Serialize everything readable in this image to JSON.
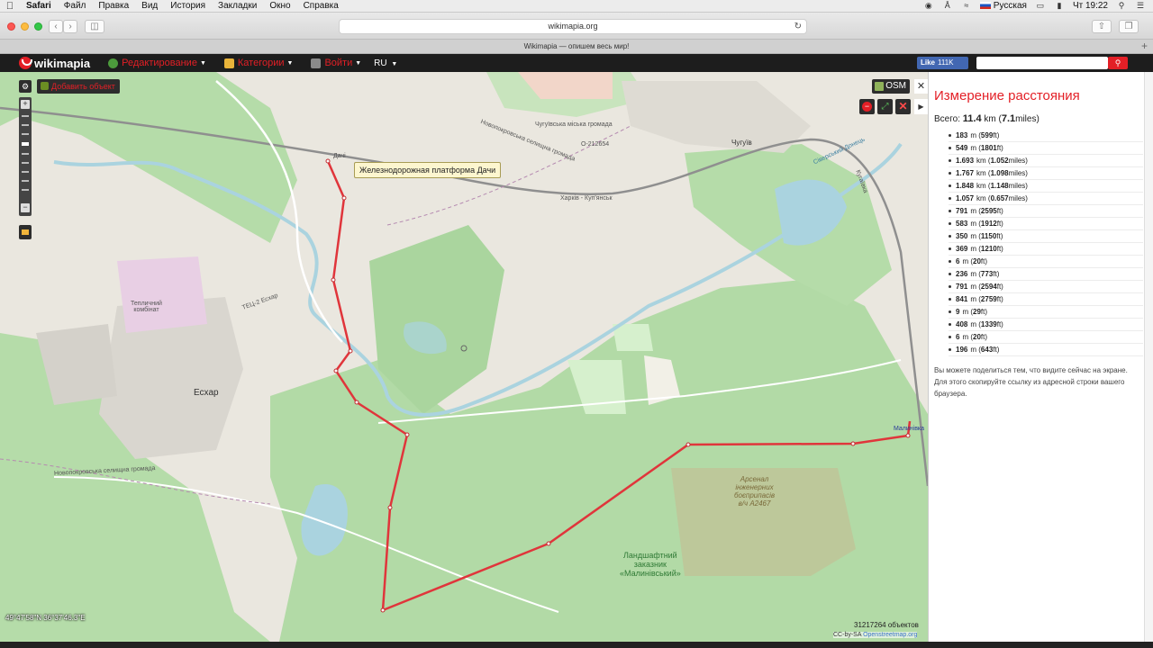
{
  "menubar": {
    "app": "Safari",
    "items": [
      "Файл",
      "Правка",
      "Вид",
      "История",
      "Закладки",
      "Окно",
      "Справка"
    ],
    "input_source": "Русская",
    "clock": "Чт 19:22"
  },
  "browser": {
    "address": "wikimapia.org",
    "tab_title": "Wikimapia — опишем весь мир!"
  },
  "header": {
    "logo": "wikimapia",
    "nav": [
      {
        "label": "Редактирование",
        "icon": "globe-icon"
      },
      {
        "label": "Категории",
        "icon": "categories-icon"
      },
      {
        "label": "Войти",
        "icon": "login-icon"
      }
    ],
    "lang": "RU",
    "like_label": "Like",
    "like_count": "111K",
    "search_placeholder": ""
  },
  "map": {
    "add_object": "Добавить объект",
    "osm_label": "OSM",
    "tooltip": "Железнодорожная платформа Дачи",
    "coords": "49°47'58\"N 36°37'46.3\"E",
    "object_count": "31217264 объектов",
    "attribution_prefix": "CC-by-SA",
    "attribution_link": "Openstreetmap.org",
    "labels": {
      "city": "Есхар",
      "teplichny": "Тепличний\nкомбінат",
      "tets": "ТЕЦ-2 Есхар",
      "chuguev": "Чугуїв",
      "chuguev_hromada": "Чугуївська міська громада",
      "novopokr": "Новопокровська селищна громада",
      "novopokr_2": "Новопокровська селищна громада",
      "kharkiv": "Харків - Куп'янськ",
      "donets": "Сіверський Донець",
      "o_road": "О-212654",
      "dachi": "Дачі",
      "malin": "Малинівка",
      "arsenal": "Арсенал\nінженерних\nбоєприпасів\nв/ч А2467",
      "landshaft": "Ландшафтний\nзаказник\n«Малинівський»",
      "kugan": "Кугаївка"
    }
  },
  "panel": {
    "title": "Измерение расстояния",
    "total_prefix": "Всего:",
    "total_km": "11.4",
    "total_km_unit": "km",
    "total_miles": "7.1",
    "total_miles_unit": "miles",
    "segments": [
      {
        "main": "183",
        "unit": "m",
        "alt": "599",
        "alt_unit": "ft"
      },
      {
        "main": "549",
        "unit": "m",
        "alt": "1801",
        "alt_unit": "ft"
      },
      {
        "main": "1.693",
        "unit": "km",
        "alt": "1.052",
        "alt_unit": "miles"
      },
      {
        "main": "1.767",
        "unit": "km",
        "alt": "1.098",
        "alt_unit": "miles"
      },
      {
        "main": "1.848",
        "unit": "km",
        "alt": "1.148",
        "alt_unit": "miles"
      },
      {
        "main": "1.057",
        "unit": "km",
        "alt": "0.657",
        "alt_unit": "miles"
      },
      {
        "main": "791",
        "unit": "m",
        "alt": "2595",
        "alt_unit": "ft"
      },
      {
        "main": "583",
        "unit": "m",
        "alt": "1912",
        "alt_unit": "ft"
      },
      {
        "main": "350",
        "unit": "m",
        "alt": "1150",
        "alt_unit": "ft"
      },
      {
        "main": "369",
        "unit": "m",
        "alt": "1210",
        "alt_unit": "ft"
      },
      {
        "main": "6",
        "unit": "m",
        "alt": "20",
        "alt_unit": "ft"
      },
      {
        "main": "236",
        "unit": "m",
        "alt": "773",
        "alt_unit": "ft"
      },
      {
        "main": "791",
        "unit": "m",
        "alt": "2594",
        "alt_unit": "ft"
      },
      {
        "main": "841",
        "unit": "m",
        "alt": "2759",
        "alt_unit": "ft"
      },
      {
        "main": "9",
        "unit": "m",
        "alt": "29",
        "alt_unit": "ft"
      },
      {
        "main": "408",
        "unit": "m",
        "alt": "1339",
        "alt_unit": "ft"
      },
      {
        "main": "6",
        "unit": "m",
        "alt": "20",
        "alt_unit": "ft"
      },
      {
        "main": "196",
        "unit": "m",
        "alt": "643",
        "alt_unit": "ft"
      }
    ],
    "share_text": "Вы можете поделиться тем, что видите сейчас на экране. Для этого скопируйте ссылку из адресной строки вашего браузера."
  },
  "colors": {
    "route": "#e0353b",
    "accent": "#e31f26",
    "forest": "#a8d5a0",
    "water": "#aad3df"
  }
}
